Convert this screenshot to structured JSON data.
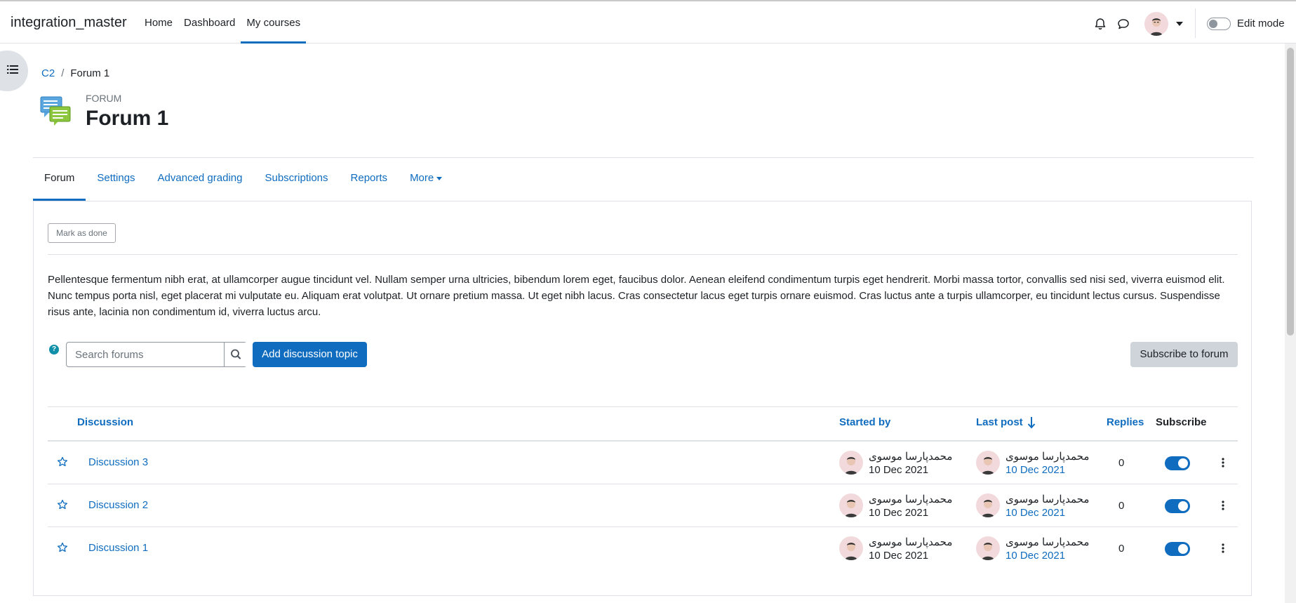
{
  "navbar": {
    "brand": "integration_master",
    "nav_items": [
      "Home",
      "Dashboard",
      "My courses"
    ],
    "active_nav": "My courses",
    "edit_mode_label": "Edit mode",
    "edit_mode_on": false
  },
  "breadcrumb": {
    "items": [
      "C2",
      "Forum 1"
    ],
    "separator": "/"
  },
  "header": {
    "kicker": "FORUM",
    "title": "Forum 1"
  },
  "tabs": {
    "items": [
      "Forum",
      "Settings",
      "Advanced grading",
      "Subscriptions",
      "Reports",
      "More"
    ],
    "active": "Forum"
  },
  "content": {
    "mark_done_label": "Mark as done",
    "intro": "Pellentesque fermentum nibh erat, at ullamcorper augue tincidunt vel. Nullam semper urna ultricies, bibendum lorem eget, faucibus dolor. Aenean eleifend condimentum turpis eget hendrerit. Morbi massa tortor, convallis sed nisi sed, viverra euismod elit. Nunc tempus porta nisl, eget placerat mi vulputate eu. Aliquam erat volutpat. Ut ornare pretium massa. Ut eget nibh lacus. Cras consectetur lacus eget turpis ornare euismod. Cras luctus ante a turpis ullamcorper, eu tincidunt lectus cursus. Suspendisse risus ante, lacinia non condimentum id, viverra luctus arcu.",
    "help_glyph": "?",
    "search_placeholder": "Search forums",
    "add_button": "Add discussion topic",
    "subscribe_button": "Subscribe to forum"
  },
  "table": {
    "headers": {
      "discussion": "Discussion",
      "started_by": "Started by",
      "last_post": "Last post",
      "replies": "Replies",
      "subscribe": "Subscribe"
    },
    "sort_column": "last_post",
    "sort_direction": "descending",
    "rows": [
      {
        "title": "Discussion 3",
        "started_by": "محمدپارسا موسوی",
        "started_date": "10 Dec 2021",
        "last_by": "محمدپارسا موسوی",
        "last_date": "10 Dec 2021",
        "replies": "0",
        "subscribed": true
      },
      {
        "title": "Discussion 2",
        "started_by": "محمدپارسا موسوی",
        "started_date": "10 Dec 2021",
        "last_by": "محمدپارسا موسوی",
        "last_date": "10 Dec 2021",
        "replies": "0",
        "subscribed": true
      },
      {
        "title": "Discussion 1",
        "started_by": "محمدپارسا موسوی",
        "started_date": "10 Dec 2021",
        "last_by": "محمدپارسا موسوی",
        "last_date": "10 Dec 2021",
        "replies": "0",
        "subscribed": true
      }
    ]
  },
  "colors": {
    "primary": "#0f6cbf",
    "text": "#1d2125",
    "muted": "#6a737b",
    "border": "#dee2e6",
    "secondary_button": "#ced4da",
    "help": "#0f8fa8"
  },
  "icons": {
    "drawer": "list-icon",
    "notifications": "bell-icon",
    "messages": "chat-icon",
    "forum": "forum-icon",
    "search": "search-icon",
    "star": "star-icon",
    "sort": "arrow-down-icon",
    "actions": "kebab-icon"
  }
}
